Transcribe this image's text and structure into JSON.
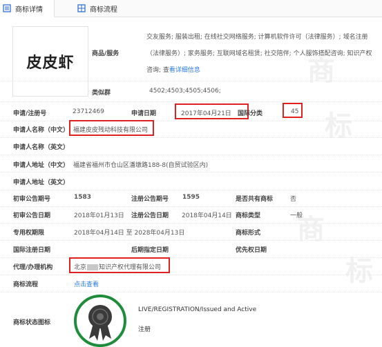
{
  "tabs": [
    {
      "label": "商标详情",
      "active": true
    },
    {
      "label": "商标流程",
      "active": false
    }
  ],
  "logo_text": "皮皮虾",
  "goods_services": {
    "label": "商品/服务",
    "text": "交友服务; 服装出租; 在线社交网络服务; 计算机软件许可（法律服务）; 域名注册（法律服务）; 家务服务; 互联网域名租赁; 社交陪伴; 个人服饰搭配咨询; 知识产权咨询; 查",
    "link": "看详细信息"
  },
  "similar_group": {
    "label": "类似群",
    "value": "4502;4503;4505;4506;"
  },
  "reg_no": {
    "label": "申请/注册号",
    "value": "23712469"
  },
  "app_date": {
    "label": "申请日期",
    "value": "2017年04月21日"
  },
  "intl_class": {
    "label": "国际分类",
    "value": "45"
  },
  "applicant_cn": {
    "label": "申请人名称（中文）",
    "value": "福建皮皮残动科技有限公司"
  },
  "applicant_en": {
    "label": "申请人名称（英文）",
    "value": ""
  },
  "address_cn": {
    "label": "申请人地址（中文）",
    "value": "福建省福州市仓山区潘墩路188-8(自贸试验区内)"
  },
  "address_en": {
    "label": "申请人地址（英文）",
    "value": ""
  },
  "prelim_pub_no": {
    "label": "初审公告期号",
    "value": "1583"
  },
  "reg_pub_no": {
    "label": "注册公告期号",
    "value": "1595"
  },
  "shared": {
    "label": "是否共有商标",
    "value": "否"
  },
  "prelim_pub_date": {
    "label": "初审公告日期",
    "value": "2018年01月13日"
  },
  "reg_pub_date": {
    "label": "注册公告日期",
    "value": "2018年04月14日"
  },
  "mark_type": {
    "label": "商标类型",
    "value": "一般"
  },
  "exclusive_period": {
    "label": "专用权期限",
    "value": "2018年04月14日 至 2028年04月13日"
  },
  "mark_form": {
    "label": "商标形式",
    "value": ""
  },
  "intl_reg_date": {
    "label": "国际注册日期",
    "value": ""
  },
  "later_date": {
    "label": "后期指定日期",
    "value": ""
  },
  "priority_date": {
    "label": "优先权日期",
    "value": ""
  },
  "agent": {
    "label": "代理/办理机构",
    "value_prefix": "北京",
    "value_suffix": "知识产权代理有限公司"
  },
  "process": {
    "label": "商标流程",
    "link": "点击查看"
  },
  "status": {
    "label": "商标状态图标",
    "en": "LIVE/REGISTRATION/Issued and Active",
    "cn": "注册"
  },
  "colors": {
    "highlight": "#e02020",
    "link": "#2a7be4",
    "badge_ring": "#1e8c3a",
    "tab_icon": "#2f6fd8"
  }
}
